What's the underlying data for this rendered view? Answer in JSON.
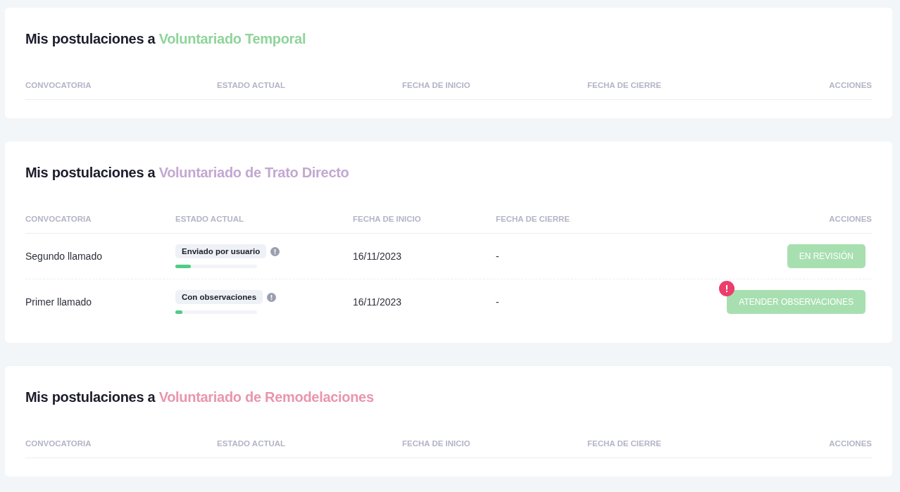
{
  "sections": [
    {
      "title": "Mis postulaciones a",
      "highlight": "Voluntariado Temporal",
      "color": "#8fd49b",
      "columns": [
        "CONVOCATORIA",
        "ESTADO ACTUAL",
        "FECHA DE INICIO",
        "FECHA DE CIERRE",
        "ACCIONES"
      ]
    },
    {
      "title": "Mis postulaciones a",
      "highlight": "Voluntariado de Trato Directo",
      "color": "#c3a8d1",
      "columns": [
        "CONVOCATORIA",
        "ESTADO ACTUAL",
        "FECHA DE INICIO",
        "FECHA DE CIERRE",
        "ACCIONES"
      ],
      "rows": [
        {
          "name": "Segundo llamado",
          "status": "Enviado por usuario",
          "level": 0.19,
          "start": "16/11/2023",
          "end": "-",
          "action": "EN REVISIÓN",
          "alert": false
        },
        {
          "name": "Primer llamado",
          "status": "Con observaciones",
          "level": 0.09,
          "start": "16/11/2023",
          "end": "-",
          "action": "ATENDER OBSERVACIONES",
          "alert": true
        }
      ]
    },
    {
      "title": "Mis postulaciones a",
      "highlight": "Voluntariado de Remodelaciones",
      "color": "#e996ab",
      "columns": [
        "CONVOCATORIA",
        "ESTADO ACTUAL",
        "FECHA DE INICIO",
        "FECHA DE CIERRE",
        "ACCIONES"
      ]
    }
  ]
}
